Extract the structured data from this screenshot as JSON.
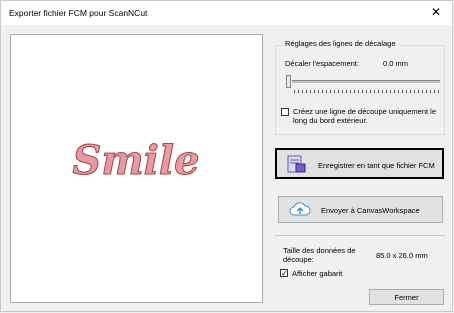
{
  "window": {
    "title": "Exporter fichier FCM pour ScanNCut",
    "close_glyph": "✕"
  },
  "preview": {
    "text": "Smile",
    "fill_color": "#e79aa2",
    "stroke_color": "#a0434c"
  },
  "offset_group": {
    "title": "Réglages des lignes de décalage",
    "offset_label": "Décaler l'espacement:",
    "offset_value": "0.0 mm",
    "slider_value": 0,
    "outer_edge_checkbox": {
      "line1": "Créez une ligne de découpe uniquement le",
      "line2": "long du bord extérieur.",
      "checked": false
    }
  },
  "buttons": {
    "save_fcm": "Enregistrer en tant que fichier FCM",
    "send_canvas": "Envoyer à CanvasWorkspace",
    "close": "Fermer"
  },
  "cut_data": {
    "label_line1": "Taille des données de",
    "label_line2": "découpe:",
    "value": "85.0 x 26.0 mm"
  },
  "show_template": {
    "label": "Afficher gabarit",
    "checked": true
  }
}
